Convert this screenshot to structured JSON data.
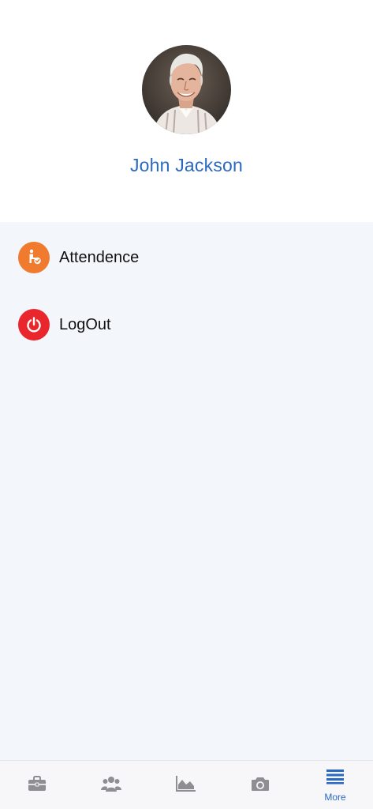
{
  "profile": {
    "name": "John Jackson"
  },
  "menu": {
    "items": [
      {
        "label": "Attendence",
        "icon": "attendance-icon",
        "color": "#f07a2d"
      },
      {
        "label": "LogOut",
        "icon": "power-icon",
        "color": "#e8262b"
      }
    ]
  },
  "tabbar": {
    "tabs": [
      {
        "icon": "briefcase-icon",
        "label": "",
        "active": false
      },
      {
        "icon": "users-icon",
        "label": "",
        "active": false
      },
      {
        "icon": "area-chart-icon",
        "label": "",
        "active": false
      },
      {
        "icon": "camera-icon",
        "label": "",
        "active": false
      },
      {
        "icon": "menu-icon",
        "label": "More",
        "active": true
      }
    ],
    "active_color": "#2a69c1",
    "inactive_color": "#8e8e93"
  }
}
